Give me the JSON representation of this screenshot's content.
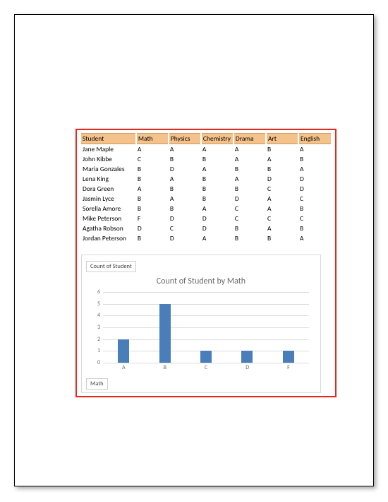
{
  "table": {
    "headers": [
      "Student",
      "Math",
      "Physics",
      "Chemistry",
      "Drama",
      "Art",
      "English"
    ],
    "rows": [
      {
        "student": "Jane Maple",
        "grades": [
          "A",
          "A",
          "A",
          "A",
          "B",
          "A"
        ]
      },
      {
        "student": "John Kibbe",
        "grades": [
          "C",
          "B",
          "B",
          "A",
          "A",
          "B"
        ]
      },
      {
        "student": "Maria Gonzales",
        "grades": [
          "B",
          "D",
          "A",
          "B",
          "B",
          "A"
        ]
      },
      {
        "student": "Lena King",
        "grades": [
          "B",
          "A",
          "B",
          "A",
          "D",
          "D"
        ]
      },
      {
        "student": "Dora Green",
        "grades": [
          "A",
          "B",
          "B",
          "B",
          "C",
          "D"
        ]
      },
      {
        "student": "Jasmin Lyce",
        "grades": [
          "B",
          "A",
          "B",
          "D",
          "A",
          "C"
        ]
      },
      {
        "student": "Sorella Amore",
        "grades": [
          "B",
          "B",
          "A",
          "C",
          "A",
          "B"
        ]
      },
      {
        "student": "Mike Peterson",
        "grades": [
          "F",
          "D",
          "D",
          "C",
          "C",
          "C"
        ]
      },
      {
        "student": "Agatha Robson",
        "grades": [
          "D",
          "C",
          "D",
          "B",
          "A",
          "B"
        ]
      },
      {
        "student": "Jordan Peterson",
        "grades": [
          "B",
          "D",
          "A",
          "B",
          "B",
          "A"
        ]
      }
    ]
  },
  "chart_data": {
    "type": "bar",
    "title": "Count of Student by Math",
    "field_label": "Count of Student",
    "axis_label": "Math",
    "categories": [
      "A",
      "B",
      "C",
      "D",
      "F"
    ],
    "values": [
      2,
      5,
      1,
      1,
      1
    ],
    "ylim": [
      0,
      6
    ],
    "ytick_step": 1,
    "bar_color": "#4a7ebb"
  }
}
